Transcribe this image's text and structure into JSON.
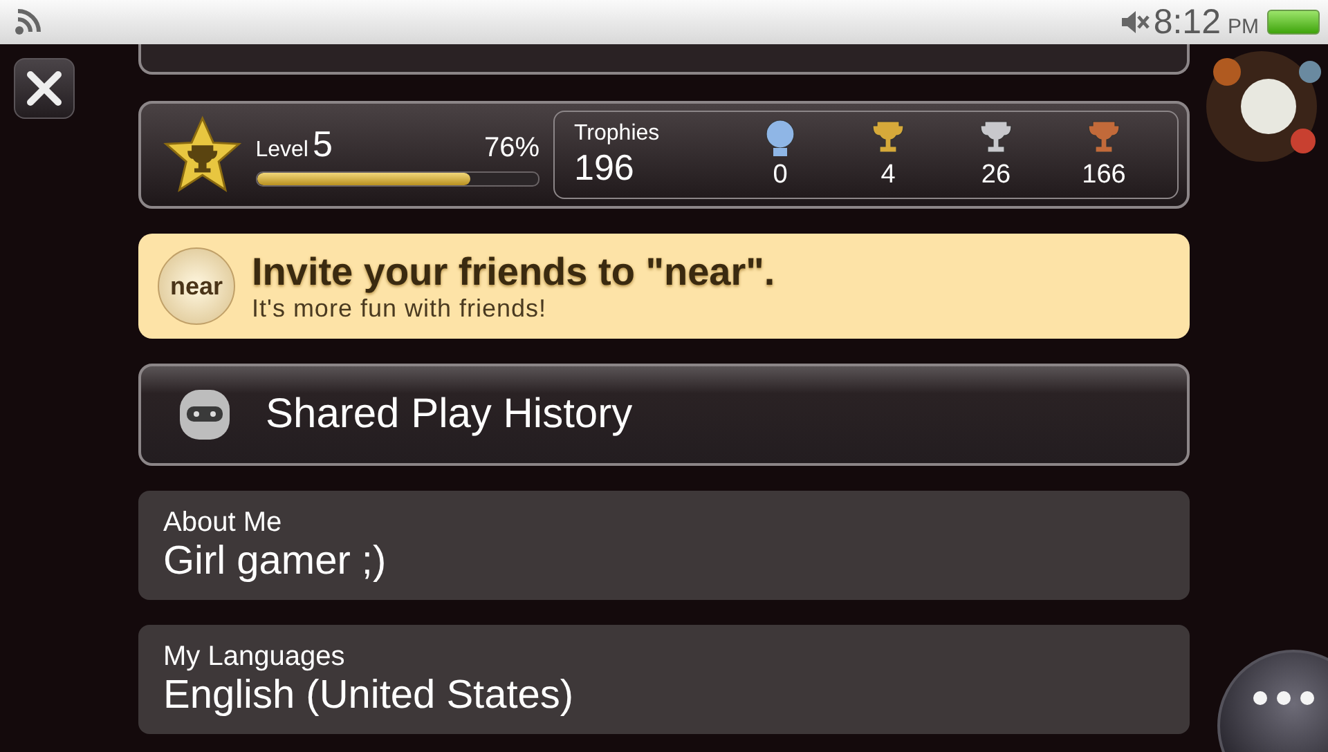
{
  "status_bar": {
    "time": "8:12",
    "meridiem": "PM",
    "muted": true
  },
  "level_card": {
    "label": "Level",
    "level_number": "5",
    "percent": "76%",
    "level": 0.76
  },
  "trophies": {
    "label": "Trophies",
    "total": "196",
    "items": [
      {
        "kind": "platinum",
        "count": "0",
        "color": "#8fb6e6"
      },
      {
        "kind": "gold",
        "count": "4",
        "color": "#d6a93a"
      },
      {
        "kind": "silver",
        "count": "26",
        "color": "#c8c8cc"
      },
      {
        "kind": "bronze",
        "count": "166",
        "color": "#c26a3a"
      }
    ]
  },
  "invite": {
    "app_icon_label": "near",
    "title": "Invite your friends to \"near\".",
    "subtitle": "It's more fun with friends!"
  },
  "shared_play": {
    "label": "Shared Play History"
  },
  "fields": [
    {
      "label": "About Me",
      "value": "Girl gamer ;)"
    },
    {
      "label": "My Languages",
      "value": "English (United States)"
    }
  ]
}
